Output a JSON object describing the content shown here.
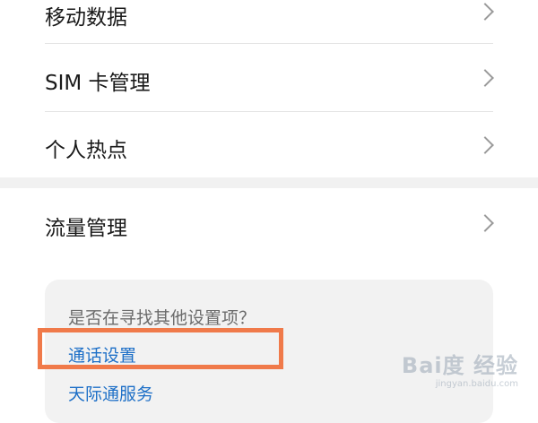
{
  "settings_list": [
    {
      "label": "移动数据"
    },
    {
      "label": "SIM 卡管理"
    },
    {
      "label": "个人热点"
    }
  ],
  "traffic_item": {
    "label": "流量管理"
  },
  "suggestions": {
    "title": "是否在寻找其他设置项？",
    "links": [
      {
        "label": "通话设置",
        "highlighted": true
      },
      {
        "label": "天际通服务"
      }
    ]
  },
  "watermark": {
    "logo": "Bai度 经验",
    "subtext": "jingyan.baidu.com"
  },
  "colors": {
    "link": "#1d6fc7",
    "highlight_border": "#f07a4a",
    "card_background": "#f2f2f2"
  }
}
